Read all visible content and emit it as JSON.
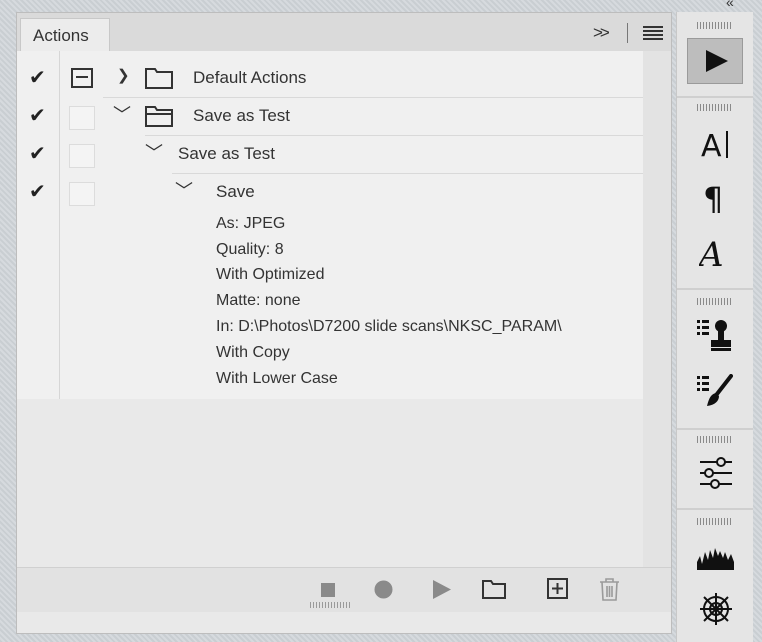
{
  "panel": {
    "tab_label": "Actions",
    "expand_glyph": ">>",
    "menu_glyph": "≡"
  },
  "rows": [
    {
      "label": "Default Actions",
      "checked": true
    },
    {
      "label": "Save as Test",
      "checked": true
    },
    {
      "label": "Save as Test",
      "checked": true
    },
    {
      "label": "Save",
      "checked": true
    }
  ],
  "details": [
    "As: JPEG",
    "Quality: 8",
    "With Optimized",
    "Matte: none",
    "In: D:\\Photos\\D7200 slide scans\\NKSC_PARAM\\",
    "With Copy",
    "With Lower Case"
  ],
  "glyphs": {
    "check": "✔",
    "chevron_right": "❯",
    "chevron_down": "﹀",
    "collapse_top": "«"
  },
  "bottom_toolbar": [
    "stop-icon",
    "record-icon",
    "play-icon",
    "new-set-icon",
    "new-action-icon",
    "delete-icon"
  ],
  "side_toolbar": [
    "actions-icon",
    "character-icon",
    "paragraph-icon",
    "glyphs-icon",
    "clone-source-icon",
    "brush-settings-icon",
    "adjustments-icon",
    "histogram-icon",
    "navigator-icon"
  ],
  "colors": {
    "panel_bg": "#f0f0f0",
    "selected_button": "#bdbdbd",
    "icon": "#222222"
  }
}
